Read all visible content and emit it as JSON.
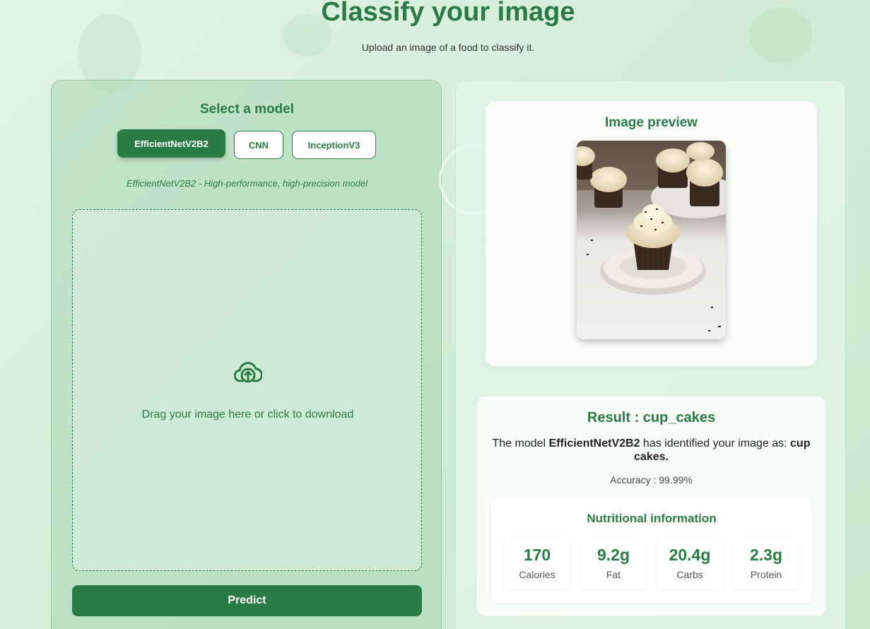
{
  "header": {
    "title": "Classify your image",
    "subtitle": "Upload an image of a food to classify it."
  },
  "model_select": {
    "title": "Select a model",
    "options": [
      {
        "label": "EfficientNetV2B2",
        "selected": true
      },
      {
        "label": "CNN",
        "selected": false
      },
      {
        "label": "InceptionV3",
        "selected": false
      }
    ],
    "description": "EfficientNetV2B2 - High-performance, high-precision model"
  },
  "dropzone": {
    "icon": "cloud-upload-icon",
    "text": "Drag your image here or click to download"
  },
  "predict_label": "Predict",
  "preview": {
    "title": "Image preview",
    "image_subject": "chocolate cupcakes with cream frosting"
  },
  "result": {
    "title": "Result : cup_cakes",
    "text_prefix": "The model ",
    "model": "EfficientNetV2B2",
    "text_middle": " has identified your image as: ",
    "label": "cup cakes.",
    "accuracy": "Accuracy : 99.99%"
  },
  "nutrition": {
    "title": "Nutritional information",
    "items": [
      {
        "value": "170",
        "label": "Calories"
      },
      {
        "value": "9.2g",
        "label": "Fat"
      },
      {
        "value": "20.4g",
        "label": "Carbs"
      },
      {
        "value": "2.3g",
        "label": "Protein"
      }
    ]
  },
  "colors": {
    "accent": "#2b7c44",
    "background": "#d2ecd7"
  }
}
